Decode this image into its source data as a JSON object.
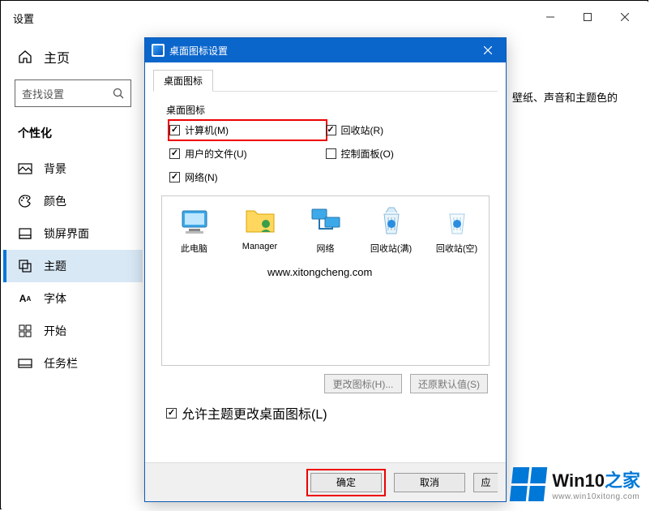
{
  "settings": {
    "title": "设置",
    "home": "主页",
    "search_placeholder": "查找设置",
    "section": "个性化",
    "nav": [
      {
        "label": "背景"
      },
      {
        "label": "颜色"
      },
      {
        "label": "锁屏界面"
      },
      {
        "label": "主题"
      },
      {
        "label": "字体"
      },
      {
        "label": "开始"
      },
      {
        "label": "任务栏"
      }
    ],
    "bg_fragment": "壁纸、声音和主题色的"
  },
  "dialog": {
    "title": "桌面图标设置",
    "tab": "桌面图标",
    "group": "桌面图标",
    "checkboxes": {
      "computer": {
        "label": "计算机(M)",
        "checked": true
      },
      "recycle": {
        "label": "回收站(R)",
        "checked": true
      },
      "userfiles": {
        "label": "用户的文件(U)",
        "checked": true
      },
      "controlpanel": {
        "label": "控制面板(O)",
        "checked": false
      },
      "network": {
        "label": "网络(N)",
        "checked": true
      }
    },
    "icons": [
      {
        "name": "此电脑"
      },
      {
        "name": "Manager"
      },
      {
        "name": "网络"
      },
      {
        "name": "回收站(满)"
      },
      {
        "name": "回收站(空)"
      }
    ],
    "watermark_url": "www.xitongcheng.com",
    "change_icon": "更改图标(H)...",
    "restore_default": "还原默认值(S)",
    "allow_themes": "允许主题更改桌面图标(L)",
    "ok": "确定",
    "cancel": "取消",
    "apply_cut": "应"
  },
  "branding": {
    "text1": "Win10",
    "text2": "之家",
    "url": "www.win10xitong.com"
  }
}
